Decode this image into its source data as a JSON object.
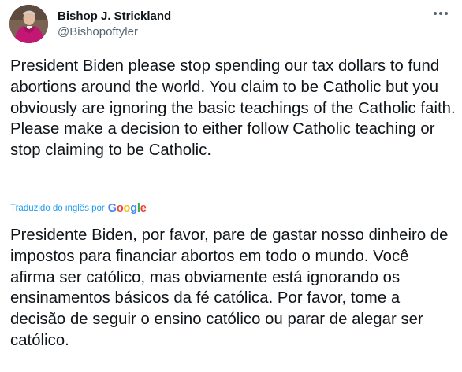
{
  "author": {
    "display_name": "Bishop J. Strickland",
    "handle": "@Bishopoftyler",
    "avatar_icon": "avatar-photo"
  },
  "menu": {
    "icon": "more-horizontal-icon"
  },
  "tweet": {
    "text": "President Biden please stop spending our tax dollars to fund abortions around the world. You claim to be Catholic but you obviously are ignoring the basic teachings of the Catholic faith. Please make a decision to either follow Catholic teaching or stop claiming to be Catholic."
  },
  "translation": {
    "label": "Traduzido do inglês por",
    "provider": "Google",
    "text": "Presidente Biden, por favor, pare de gastar nosso dinheiro de impostos para financiar abortos em todo o mundo. Você afirma ser católico, mas obviamente está ignorando os ensinamentos básicos da fé católica. Por favor, tome a decisão de seguir o ensino católico ou parar de alegar ser católico."
  },
  "colors": {
    "link": "#1d9bf0",
    "secondary_text": "#536471",
    "primary_text": "#0f1419",
    "google_blue": "#4285f4",
    "google_red": "#ea4335",
    "google_yellow": "#fbbc05",
    "google_green": "#34a853"
  }
}
